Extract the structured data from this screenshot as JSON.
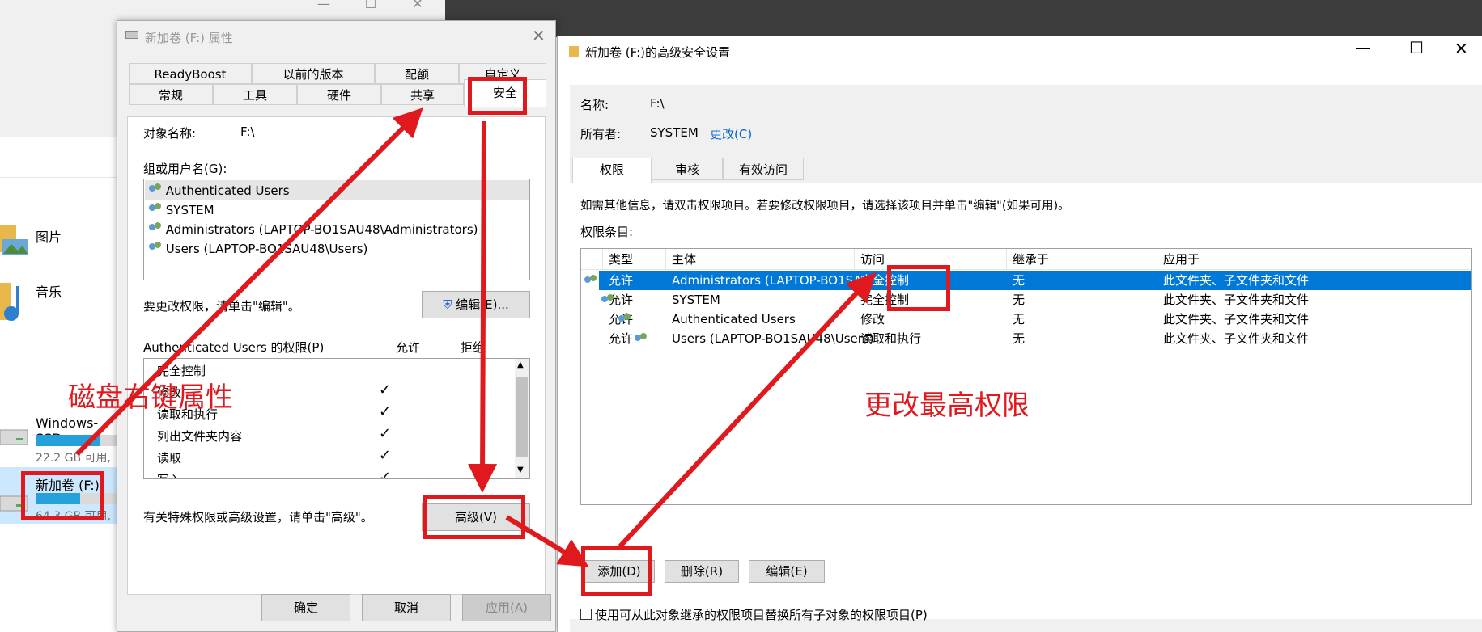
{
  "explorer": {
    "nav_items": [
      {
        "label": "图片",
        "icon": "pictures-folder-icon"
      },
      {
        "label": "音乐",
        "icon": "music-folder-icon"
      }
    ],
    "drives": [
      {
        "name": "Windows-SSD",
        "free": "22.2 GB 可用,",
        "fill": 0.8
      },
      {
        "name": "新加卷 (F:)",
        "free": "64.3 GB 可用,",
        "fill": 0.55
      }
    ]
  },
  "props": {
    "title": "新加卷 (F:) 属性",
    "tabs_row1": [
      "ReadyBoost",
      "以前的版本",
      "配额",
      "自定义"
    ],
    "tabs_row2": [
      "常规",
      "工具",
      "硬件",
      "共享",
      "安全"
    ],
    "object_label": "对象名称:",
    "object_value": "F:\\",
    "groups_label": "组或用户名(G):",
    "groups": [
      "Authenticated Users",
      "SYSTEM",
      "Administrators (LAPTOP-BO1SAU48\\Administrators)",
      "Users (LAPTOP-BO1SAU48\\Users)"
    ],
    "change_hint": "要更改权限，请单击\"编辑\"。",
    "edit_button": "编辑(E)...",
    "perm_label": "Authenticated Users 的权限(P)",
    "allow_header": "允许",
    "deny_header": "拒绝",
    "permissions": [
      {
        "name": "完全控制",
        "allow": false
      },
      {
        "name": "修改",
        "allow": true
      },
      {
        "name": "读取和执行",
        "allow": true
      },
      {
        "name": "列出文件夹内容",
        "allow": true
      },
      {
        "name": "读取",
        "allow": true
      },
      {
        "name": "写入",
        "allow": true
      }
    ],
    "advanced_hint": "有关特殊权限或高级设置，请单击\"高级\"。",
    "advanced_button": "高级(V)",
    "ok_button": "确定",
    "cancel_button": "取消",
    "apply_button": "应用(A)"
  },
  "adv": {
    "title": "新加卷 (F:)的高级安全设置",
    "name_label": "名称:",
    "name_value": "F:\\",
    "owner_label": "所有者:",
    "owner_value": "SYSTEM",
    "owner_change": "更改(C)",
    "tabs": [
      "权限",
      "审核",
      "有效访问"
    ],
    "info": "如需其他信息，请双击权限项目。若要修改权限项目，请选择该项目并单击\"编辑\"(如果可用)。",
    "entries_label": "权限条目:",
    "columns": [
      "类型",
      "主体",
      "访问",
      "继承于",
      "应用于"
    ],
    "rows": [
      {
        "type": "允许",
        "principal": "Administrators (LAPTOP-BO1SAU...",
        "access": "完全控制",
        "inherited": "无",
        "applies": "此文件夹、子文件夹和文件"
      },
      {
        "type": "允许",
        "principal": "SYSTEM",
        "access": "完全控制",
        "inherited": "无",
        "applies": "此文件夹、子文件夹和文件"
      },
      {
        "type": "允许",
        "principal": "Authenticated Users",
        "access": "修改",
        "inherited": "无",
        "applies": "此文件夹、子文件夹和文件"
      },
      {
        "type": "允许",
        "principal": "Users (LAPTOP-BO1SAU48\\Users)",
        "access": "读取和执行",
        "inherited": "无",
        "applies": "此文件夹、子文件夹和文件"
      }
    ],
    "add_button": "添加(D)",
    "remove_button": "删除(R)",
    "edit_button": "编辑(E)",
    "replace_checkbox": "使用可从此对象继承的权限项目替换所有子对象的权限项目(P)"
  },
  "annotations": {
    "left_text": "磁盘右键属性",
    "right_text": "更改最高权限",
    "color": "#e0191e"
  }
}
